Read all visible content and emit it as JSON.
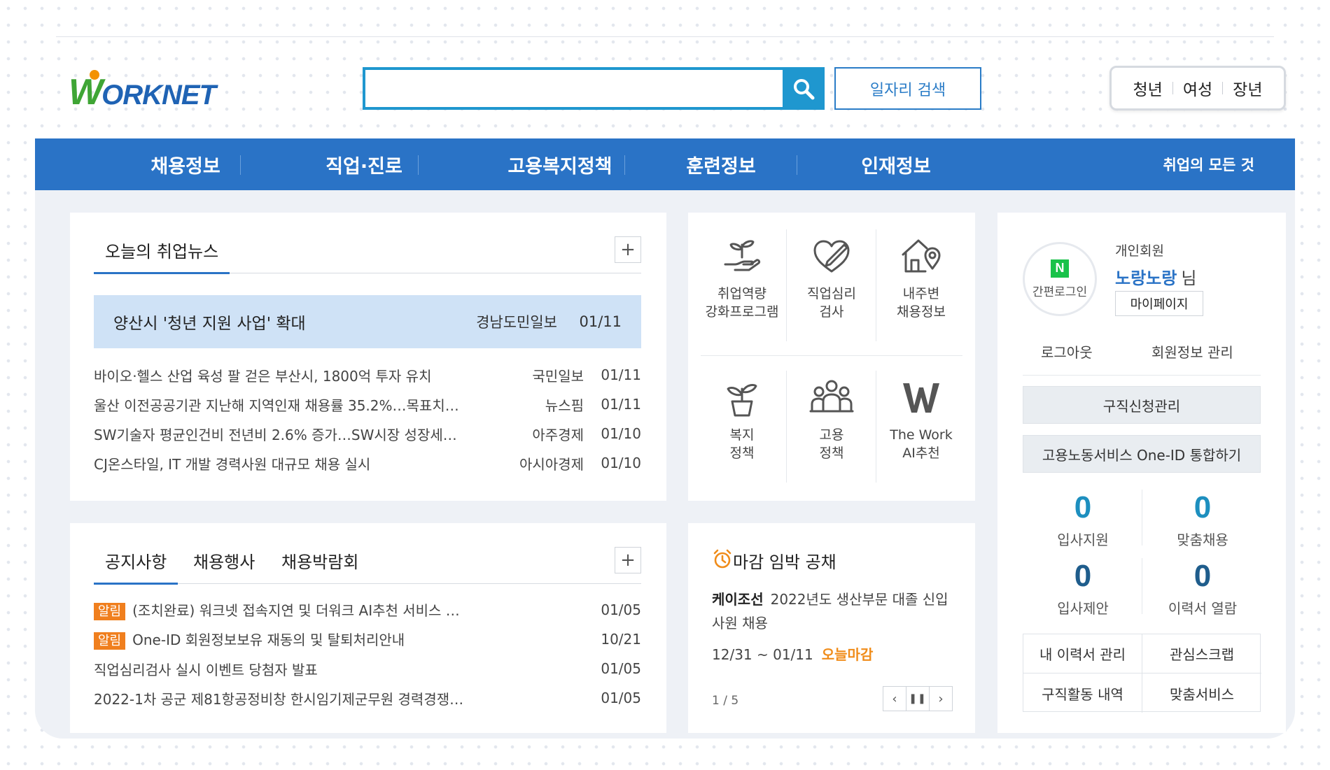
{
  "header": {
    "logo_w": "W",
    "logo_rest": "ORKNET",
    "search": {
      "value": "",
      "placeholder": ""
    },
    "job_search_label": "일자리 검색",
    "target_groups": [
      "청년",
      "여성",
      "장년"
    ]
  },
  "nav": {
    "items": [
      "채용정보",
      "직업·진로",
      "고용복지정책",
      "훈련정보",
      "인재정보"
    ],
    "all_label": "취업의 모든 것"
  },
  "news": {
    "tab_label": "오늘의 취업뉴스",
    "more": "+",
    "headline": {
      "title": "양산시 '청년 지원 사업' 확대",
      "source": "경남도민일보",
      "date": "01/11"
    },
    "rows": [
      {
        "title": "바이오·헬스 산업 육성 팔 걷은 부산시, 1800억 투자 유치",
        "source": "국민일보",
        "date": "01/11"
      },
      {
        "title": "울산 이전공공기관 지난해 지역인재 채용률 35.2%…목표치…",
        "source": "뉴스핌",
        "date": "01/11"
      },
      {
        "title": "SW기술자 평균인건비 전년비 2.6% 증가…SW시장 성장세…",
        "source": "아주경제",
        "date": "01/10"
      },
      {
        "title": "CJ온스타일, IT 개발 경력사원 대규모 채용 실시",
        "source": "아시아경제",
        "date": "01/10"
      }
    ]
  },
  "notices": {
    "tabs": [
      "공지사항",
      "채용행사",
      "채용박람회"
    ],
    "more": "+",
    "badge_label": "알림",
    "rows": [
      {
        "badge": true,
        "title": "(조치완료) 워크넷 접속지연 및 더워크 AI추천 서비스 …",
        "date": "01/05"
      },
      {
        "badge": true,
        "title": "One-ID 회원정보보유 재동의 및 탈퇴처리안내",
        "date": "10/21"
      },
      {
        "badge": false,
        "title": "직업심리검사 실시 이벤트 당첨자 발표",
        "date": "01/05"
      },
      {
        "badge": false,
        "title": "2022-1차 공군 제81항공정비창 한시임기제군무원 경력경쟁…",
        "date": "01/05"
      }
    ]
  },
  "quick_menu": {
    "items": [
      {
        "label": "취업역량\n강화프로그램",
        "icon": "sprout-hand-icon"
      },
      {
        "label": "직업심리\n검사",
        "icon": "heart-pen-icon"
      },
      {
        "label": "내주변\n채용정보",
        "icon": "house-pin-icon"
      },
      {
        "label": "복지\n정책",
        "icon": "potted-plant-icon"
      },
      {
        "label": "고용\n정책",
        "icon": "people-group-icon"
      },
      {
        "label": "The Work\nAI추천",
        "icon": "w-logo-icon"
      }
    ]
  },
  "deadline": {
    "title": "마감 임박 공채",
    "company": "케이조선",
    "job": "2022년도 생산부문 대졸 신입사원 채용",
    "period": "12/31 ~ 01/11",
    "status": "오늘마감",
    "pager": "1 / 5",
    "accent": "#f08c1a"
  },
  "user": {
    "simple_login_badge": "N",
    "simple_login_label": "간편로그인",
    "member_type": "개인회원",
    "member_name": "노랑노랑",
    "name_suffix": "님",
    "mypage_label": "마이페이지",
    "logout_label": "로그아웃",
    "manage_label": "회원정보 관리",
    "job_application_label": "구직신청관리",
    "oneid_label": "고용노동서비스 One-ID 통합하기",
    "stats": [
      {
        "label": "입사지원",
        "value": "0",
        "color": "#1d8fbf"
      },
      {
        "label": "맞춤채용",
        "value": "0",
        "color": "#1d8fbf"
      },
      {
        "label": "입사제안",
        "value": "0",
        "color": "#1f5d8c"
      },
      {
        "label": "이력서 열람",
        "value": "0",
        "color": "#1f5d8c"
      }
    ],
    "links": [
      "내 이력서 관리",
      "관심스크랩",
      "구직활동 내역",
      "맞춤서비스"
    ]
  },
  "colors": {
    "brand_blue": "#2a73c6",
    "search_blue": "#1f97cf",
    "logo_green": "#3fa535",
    "alert_orange": "#f07f1e"
  }
}
